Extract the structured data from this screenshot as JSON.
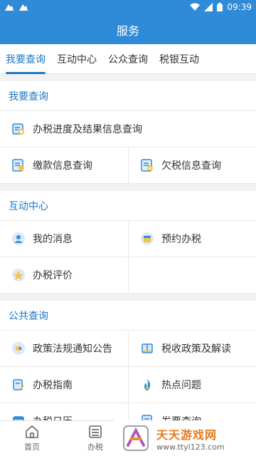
{
  "statusbar": {
    "time": "09:39"
  },
  "titlebar": {
    "title": "服务"
  },
  "tabs": [
    {
      "label": "我要查询",
      "active": true
    },
    {
      "label": "互动中心"
    },
    {
      "label": "公众查询"
    },
    {
      "label": "税银互动"
    }
  ],
  "sections": {
    "query": {
      "title": "我要查询",
      "items": [
        "办税进度及结果信息查询",
        "缴款信息查询",
        "欠税信息查询"
      ]
    },
    "interact": {
      "title": "互动中心",
      "items": [
        "我的消息",
        "预约办税",
        "办税评价"
      ]
    },
    "public": {
      "title": "公共查询",
      "items": [
        "政策法规通知公告",
        "税收政策及解读",
        "办税指南",
        "热点问题",
        "办税日历",
        "发票查询"
      ]
    }
  },
  "bottomnav": {
    "home": "首页",
    "tax": "办税"
  },
  "watermark": {
    "brand": "天天游戏网",
    "url": "www.ttyl123.com"
  },
  "colors": {
    "primary": "#2f8bd8",
    "active_tab": "#1e78c8"
  }
}
